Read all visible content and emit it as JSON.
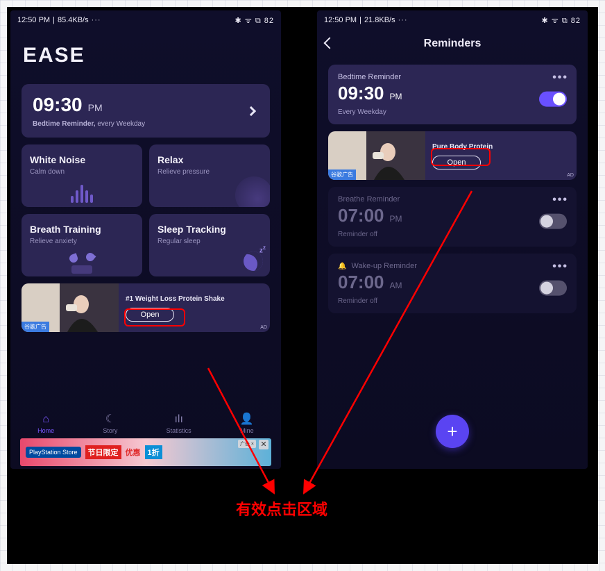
{
  "left": {
    "status": {
      "time": "12:50 PM",
      "net": "85.4KB/s",
      "extra": "···",
      "icons": "✱ ᯤ ⧉ 82"
    },
    "app_title": "EASE",
    "bedtime": {
      "time": "09:30",
      "ampm": "PM",
      "subPrefix": "Bedtime Reminder,",
      "subSuffix": "every Weekday"
    },
    "features": [
      {
        "name": "White Noise",
        "hint": "Calm down"
      },
      {
        "name": "Relax",
        "hint": "Relieve pressure"
      },
      {
        "name": "Breath Training",
        "hint": "Relieve anxiety"
      },
      {
        "name": "Sleep Tracking",
        "hint": "Regular sleep"
      }
    ],
    "ad": {
      "title": "#1 Weight Loss Protein Shake",
      "open": "Open",
      "tag": "谷歌广告",
      "badge": "AD"
    },
    "nav": [
      {
        "label": "Home",
        "icon": "⌂"
      },
      {
        "label": "Story",
        "icon": "☾"
      },
      {
        "label": "Statistics",
        "icon": "ılı"
      },
      {
        "label": "Mine",
        "icon": "👤"
      }
    ],
    "banner": {
      "ps": "PlayStation Store",
      "txt1": "节日限定",
      "txt2": "优惠",
      "txt3": "1折",
      "adtag": "广告 ×"
    }
  },
  "right": {
    "status": {
      "time": "12:50 PM",
      "net": "21.8KB/s",
      "extra": "···",
      "icons": "✱ ᯤ ⧉ 82"
    },
    "header": "Reminders",
    "reminders": [
      {
        "title": "Bedtime Reminder",
        "time": "09:30",
        "ampm": "PM",
        "sub": "Every Weekday",
        "on": true,
        "bell": false
      },
      {
        "title": "Breathe Reminder",
        "time": "07:00",
        "ampm": "PM",
        "sub": "Reminder off",
        "on": false,
        "bell": false
      },
      {
        "title": "Wake-up Reminder",
        "time": "07:00",
        "ampm": "AM",
        "sub": "Reminder off",
        "on": false,
        "bell": true
      }
    ],
    "ad": {
      "title": "Pure Body Protein",
      "open": "Open",
      "tag": "谷歌广告",
      "badge": "AD"
    },
    "fab": "+"
  },
  "caption": "有效点击区域"
}
